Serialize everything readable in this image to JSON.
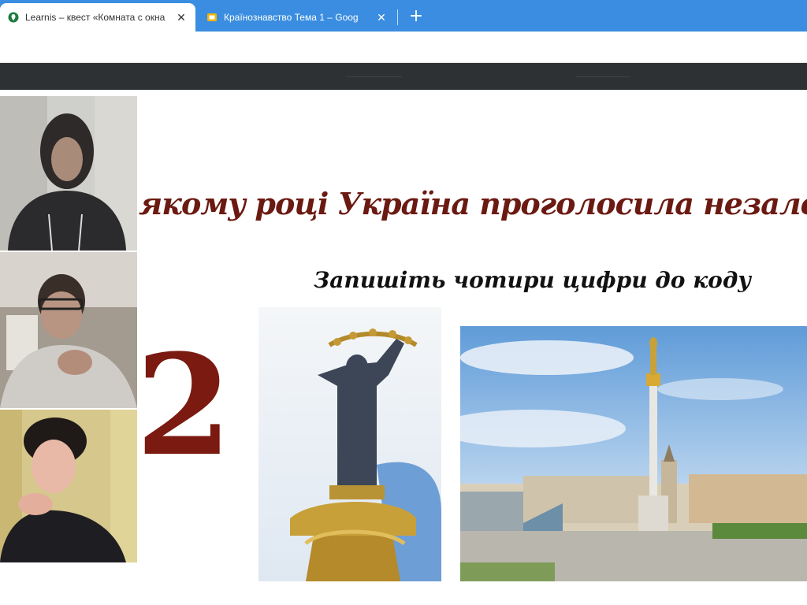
{
  "browser": {
    "tabs": [
      {
        "title": "Learnis – квест «Комната с окна",
        "icon": "learnis-favicon",
        "active": true
      },
      {
        "title": "Країнознавство Тема 1 – Goog",
        "icon": "google-slides-favicon",
        "active": false
      }
    ],
    "close_glyph": "✕",
    "new_tab_glyph": "+",
    "colors": {
      "tabbar": "#3a8de0",
      "header": "#2d3133"
    }
  },
  "participants": [
    {
      "name": "participant-1"
    },
    {
      "name": "participant-2"
    },
    {
      "name": "participant-3"
    }
  ],
  "slide": {
    "title": "якому році Україна проголосила незалежність",
    "subtitle": "Запишіть чотири цифри до коду",
    "digit": "2",
    "title_color": "#6b1a12",
    "images": [
      {
        "name": "independence-monument-statue-photo"
      },
      {
        "name": "maidan-nezalezhnosti-square-photo"
      }
    ]
  }
}
